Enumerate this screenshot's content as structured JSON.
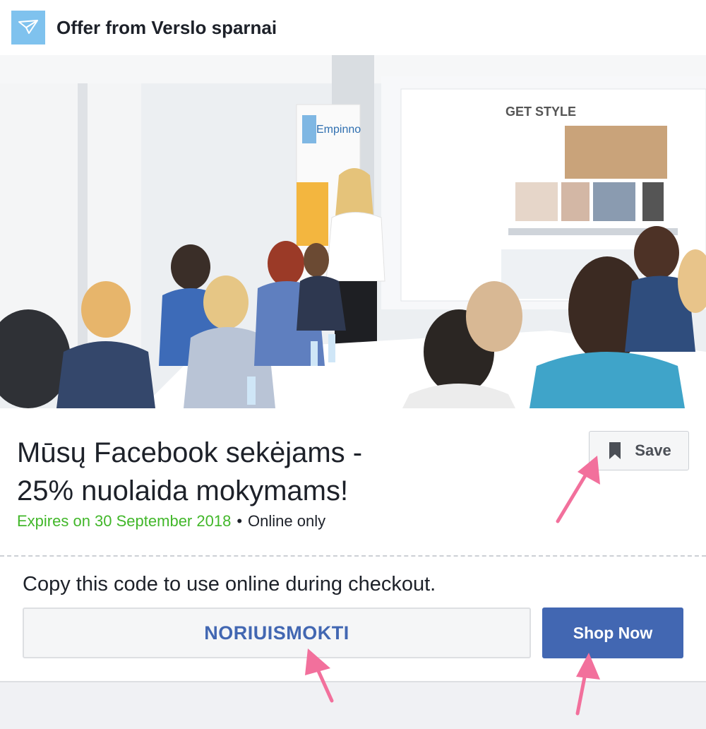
{
  "header": {
    "title": "Offer from Verslo sparnai",
    "logo_icon": "paper-plane-icon",
    "logo_color": "#7fc2ee"
  },
  "photo": {
    "banner_text": "Empinno",
    "screen_text": "GET STYLE"
  },
  "offer": {
    "title_line1": "Mūsų Facebook sekėjams -",
    "title_line2": "25% nuolaida mokymams!",
    "expires": "Expires on 30 September 2018",
    "separator": "•",
    "availability": "Online only"
  },
  "save": {
    "label": "Save",
    "icon": "bookmark-icon"
  },
  "code_section": {
    "instruction": "Copy this code to use online during checkout.",
    "code": "NORIUISMOKTI"
  },
  "shop": {
    "label": "Shop Now"
  },
  "colors": {
    "accent": "#4267b2",
    "expires": "#42b72a",
    "arrow": "#f2709c"
  }
}
